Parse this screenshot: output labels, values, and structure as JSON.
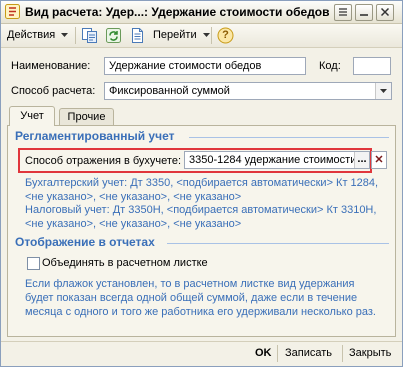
{
  "window": {
    "title": "Вид расчета: Удер...: Удержание стоимости обедов"
  },
  "toolbar": {
    "actions_label": "Действия",
    "goto_label": "Перейти",
    "help_label": "?"
  },
  "form": {
    "name_label": "Наименование:",
    "name_value": "Удержание стоимости обедов",
    "code_label": "Код:",
    "code_value": "",
    "method_label": "Способ расчета:",
    "method_value": "Фиксированной суммой"
  },
  "tabs": [
    "Учет",
    "Прочие"
  ],
  "accounting": {
    "section_title": "Регламентированный учет",
    "reflection_label": "Способ отражения в бухучете:",
    "reflection_value": "3350-1284 удержание стоимости",
    "select_button": "...",
    "clear_button": "✕",
    "info_lines": [
      "Бухгалтерский учет: Дт 3350, <подбирается автоматически> Кт 1284,",
      "<не указано>, <не указано>, <не указано>",
      "Налоговый учет: Дт 3350Н, <подбирается автоматически> Кт 3310Н,",
      "<не указано>, <не указано>, <не указано>"
    ]
  },
  "reports": {
    "section_title": "Отображение в отчетах",
    "combine_label": "Объединять в расчетном листке",
    "combine_checked": false,
    "hint_lines": [
      "Если флажок установлен, то в расчетном листке вид удержания",
      "будет показан всегда одной общей суммой, даже если в течение",
      "месяца с одного и того же работника его удерживали несколько раз."
    ]
  },
  "buttons": {
    "ok": "OK",
    "save": "Записать",
    "close": "Закрыть"
  },
  "colors": {
    "accent_blue": "#3a6fb8",
    "highlight_red": "#e0363c"
  }
}
